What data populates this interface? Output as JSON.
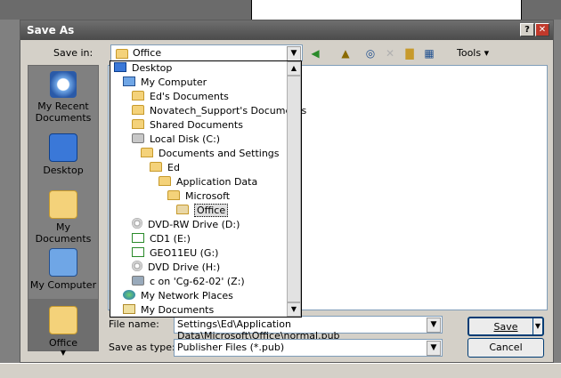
{
  "dialog": {
    "title": "Save As",
    "help_btn": "?",
    "close_btn": "✕"
  },
  "save_in": {
    "label": "Save in:",
    "value": "Office"
  },
  "toolbar": {
    "tools_label": "Tools"
  },
  "places": [
    {
      "label": "My Recent Documents",
      "icon": "recent-documents-icon"
    },
    {
      "label": "Desktop",
      "icon": "desktop-icon"
    },
    {
      "label": "My Documents",
      "icon": "my-documents-icon"
    },
    {
      "label": "My Computer",
      "icon": "my-computer-icon"
    },
    {
      "label": "Office",
      "icon": "office-folder-icon"
    }
  ],
  "dropdown_items": [
    {
      "label": "Desktop",
      "icon": "desktop-icon"
    },
    {
      "label": "My Computer",
      "icon": "computer-icon"
    },
    {
      "label": "Ed's Documents",
      "icon": "folder-icon"
    },
    {
      "label": "Novatech_Support's Documents",
      "icon": "folder-icon"
    },
    {
      "label": "Shared Documents",
      "icon": "folder-icon"
    },
    {
      "label": "Local Disk (C:)",
      "icon": "drive-icon"
    },
    {
      "label": "Documents and Settings",
      "icon": "folder-icon"
    },
    {
      "label": "Ed",
      "icon": "folder-icon"
    },
    {
      "label": "Application Data",
      "icon": "folder-icon"
    },
    {
      "label": "Microsoft",
      "icon": "folder-icon"
    },
    {
      "label": "Office",
      "icon": "folder-open-icon"
    },
    {
      "label": "DVD-RW Drive (D:)",
      "icon": "cd-drive-icon"
    },
    {
      "label": "CD1 (E:)",
      "icon": "removable-disk-icon"
    },
    {
      "label": "GEO11EU (G:)",
      "icon": "removable-disk-icon"
    },
    {
      "label": "DVD Drive (H:)",
      "icon": "cd-drive-icon"
    },
    {
      "label": "c on 'Cg-62-02' (Z:)",
      "icon": "network-drive-icon"
    },
    {
      "label": "My Network Places",
      "icon": "network-places-icon"
    },
    {
      "label": "My Documents",
      "icon": "my-documents-icon"
    }
  ],
  "file_name": {
    "label": "File name:",
    "value": "Settings\\Ed\\Application Data\\Microsoft\\Office\\normal.pub"
  },
  "save_as_type": {
    "label": "Save as type:",
    "value": "Publisher Files (*.pub)"
  },
  "buttons": {
    "save": "Save",
    "cancel": "Cancel"
  }
}
